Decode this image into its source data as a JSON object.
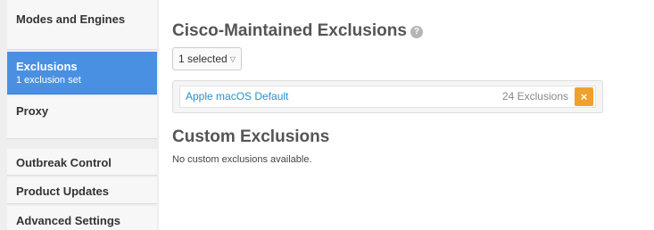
{
  "sidebar": {
    "items": [
      {
        "label": "Modes and Engines"
      },
      {
        "label": "Exclusions",
        "sublabel": "1 exclusion set"
      },
      {
        "label": "Proxy"
      },
      {
        "label": "Outbreak Control"
      },
      {
        "label": "Product Updates"
      },
      {
        "label": "Advanced Settings"
      }
    ]
  },
  "main": {
    "cisco_title": "Cisco-Maintained Exclusions",
    "help_icon": "?",
    "dropdown_label": "1 selected",
    "dropdown_chevron": "▽",
    "exclusions": [
      {
        "name": "Apple macOS Default",
        "count": "24 Exclusions",
        "remove": "×"
      }
    ],
    "custom_title": "Custom Exclusions",
    "custom_empty": "No custom exclusions available."
  },
  "colors": {
    "active_nav": "#4a90e2",
    "link": "#2a8fc8",
    "remove_button": "#f0a02c",
    "sidebar_bg": "#eeeeee"
  },
  "icons": {
    "help": "question-circle-icon",
    "dropdown": "chevron-down-icon",
    "remove": "close-icon"
  }
}
